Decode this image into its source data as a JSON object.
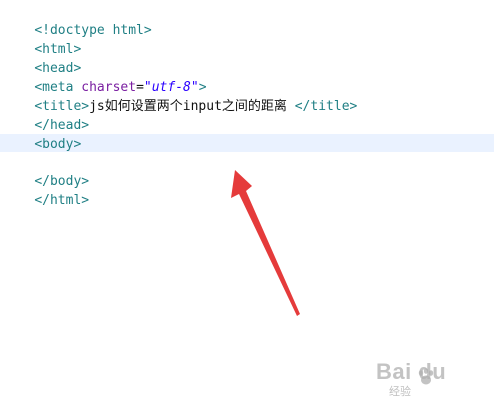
{
  "editor": {
    "lines": [
      {
        "parts": [
          "<!doctype html>"
        ]
      },
      {
        "parts": [
          "<html>"
        ]
      },
      {
        "parts": [
          "<head>"
        ]
      },
      {
        "parts": [
          "<meta ",
          "charset",
          "=",
          "\"utf-8\"",
          ">"
        ]
      },
      {
        "parts": [
          "<title>",
          "js如何设置两个input之间的距离",
          " </title>"
        ]
      },
      {
        "parts": [
          "</head>"
        ]
      },
      {
        "parts": [
          "<body>"
        ]
      },
      {
        "parts": [
          ""
        ]
      },
      {
        "parts": [
          "</body>"
        ]
      },
      {
        "parts": [
          "</html>"
        ]
      }
    ]
  },
  "watermark": {
    "brand": "Bai  du",
    "sub": "经验"
  },
  "colors": {
    "tag": "#1f7f84",
    "attribute": "#7a1ea1",
    "string": "#2a00ff",
    "cursor_line": "#eaf2ff",
    "arrow": "#e53b3b"
  }
}
